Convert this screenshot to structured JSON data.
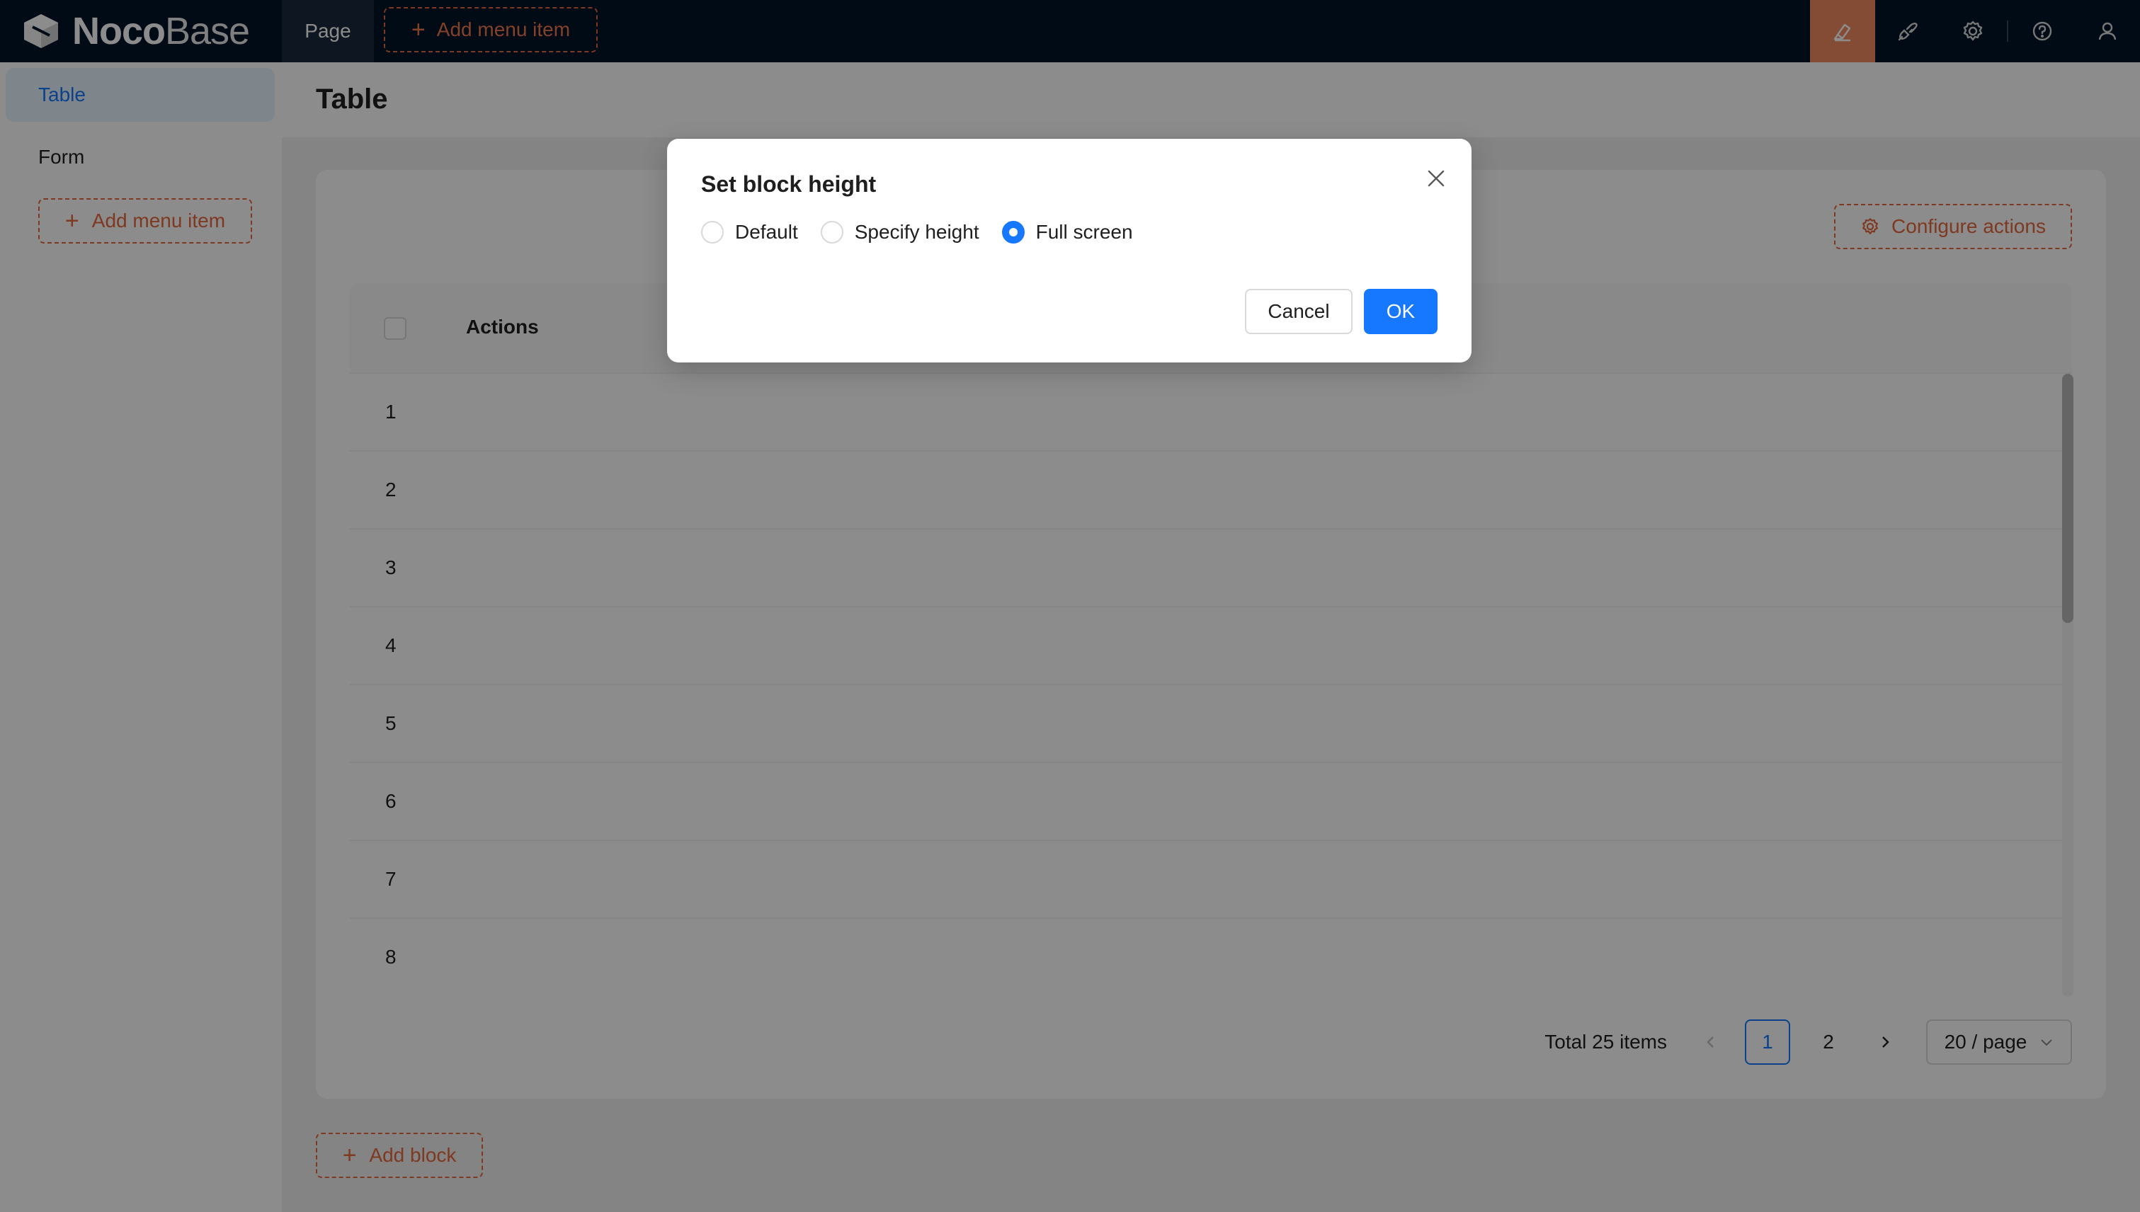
{
  "app": {
    "logo_bold": "Noco",
    "logo_light": "Base"
  },
  "topbar": {
    "page_label": "Page",
    "add_menu_item_label": "Add menu item",
    "icons": [
      "highlighter-icon",
      "plugin-icon",
      "gear-icon",
      "question-icon",
      "user-icon"
    ]
  },
  "sidebar": {
    "items": [
      {
        "label": "Table",
        "selected": true
      },
      {
        "label": "Form",
        "selected": false
      }
    ],
    "add_menu_item_label": "Add menu item"
  },
  "page": {
    "title": "Table"
  },
  "table_block": {
    "configure_actions_label": "Configure actions",
    "columns": [
      "Actions"
    ],
    "rows": [
      "1",
      "2",
      "3",
      "4",
      "5",
      "6",
      "7",
      "8"
    ],
    "pagination": {
      "total_text": "Total 25 items",
      "pages": [
        "1",
        "2"
      ],
      "current_page": "1",
      "page_size": "20 / page"
    }
  },
  "add_block_label": "Add block",
  "modal": {
    "title": "Set block height",
    "options": [
      {
        "label": "Default",
        "checked": false
      },
      {
        "label": "Specify height",
        "checked": false
      },
      {
        "label": "Full screen",
        "checked": true
      }
    ],
    "cancel_label": "Cancel",
    "ok_label": "OK"
  },
  "colors": {
    "primary": "#1677ff",
    "accent": "#e5683b",
    "header_bg": "#001529",
    "active_tool": "#f18b61"
  }
}
